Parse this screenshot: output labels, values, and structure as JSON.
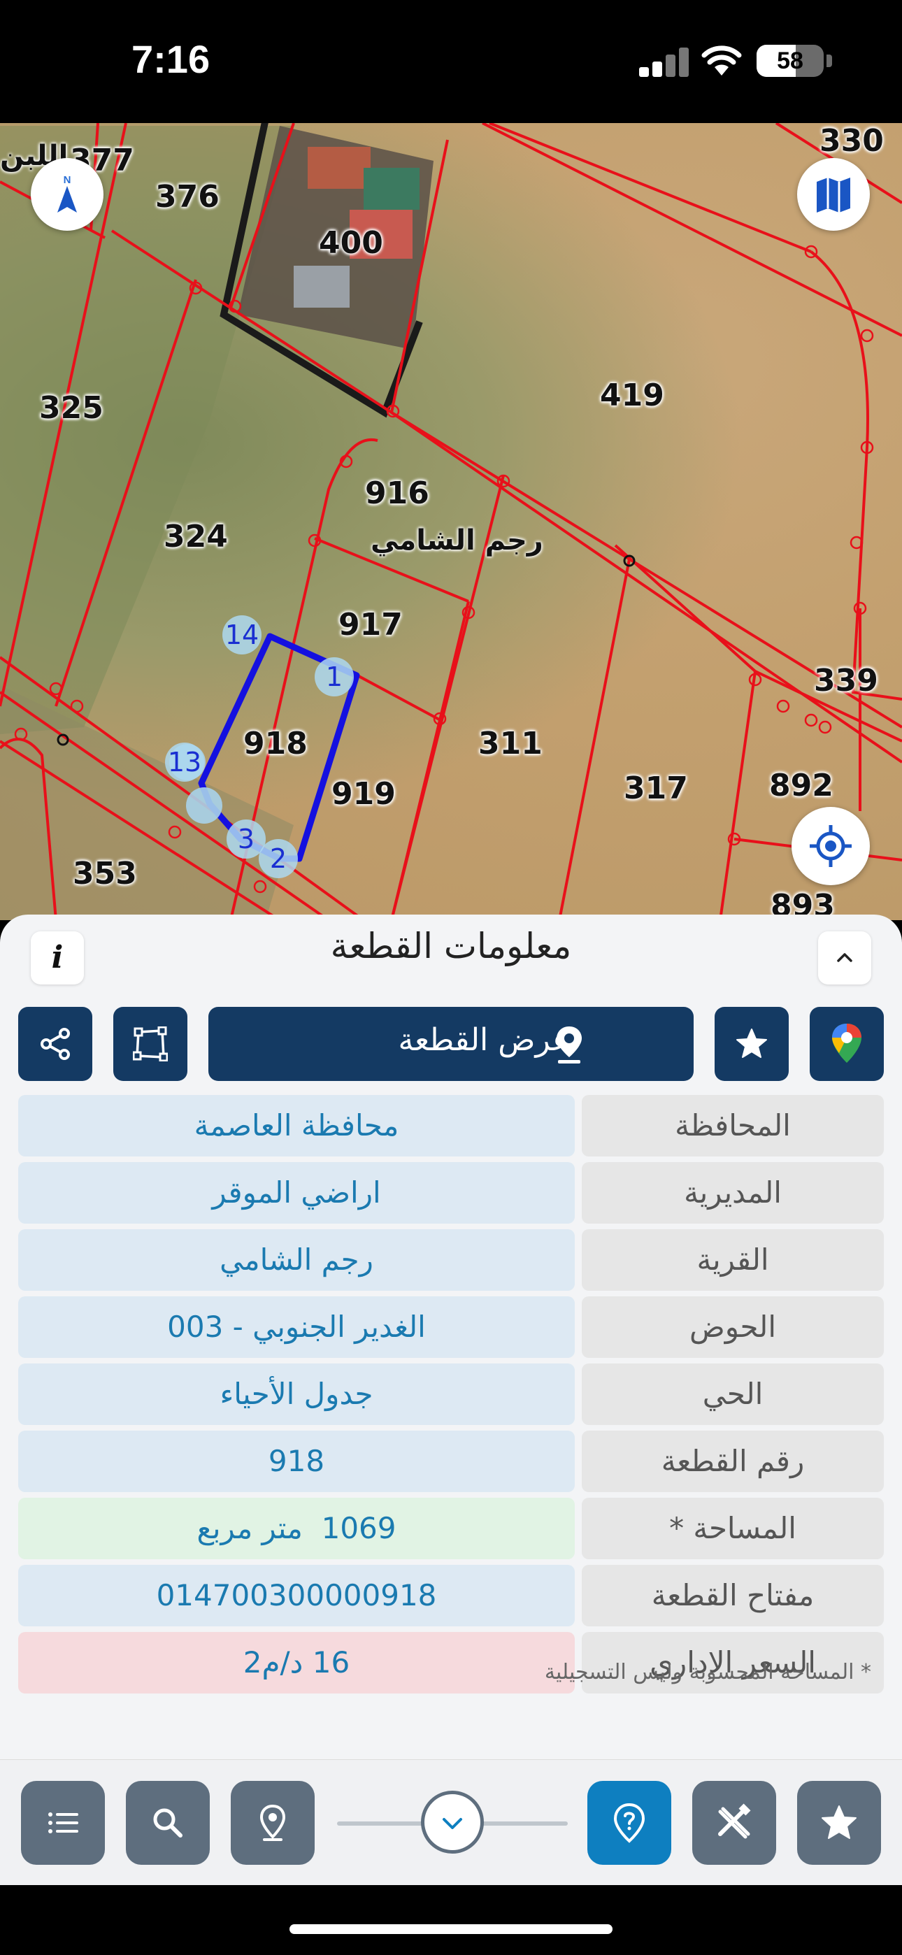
{
  "status_bar": {
    "time": "7:16",
    "battery_percent": 58,
    "battery_level": 0.58
  },
  "map": {
    "parcels": [
      "376",
      "400",
      "377",
      "330",
      "325",
      "419",
      "916",
      "324",
      "917",
      "918",
      "919",
      "311",
      "317",
      "892",
      "339",
      "353",
      "893"
    ],
    "place_names": [
      "رجم الشامي",
      "اللبن"
    ],
    "vertices": [
      "14",
      "1",
      "13",
      "3",
      "2"
    ],
    "icons": {
      "north": "compass-north-icon",
      "layers": "map-layers-icon",
      "locate": "locate-me-icon"
    },
    "north_label": "N",
    "colors": {
      "parcel_lines": "#e8101a",
      "selected_parcel": "#1410e0"
    }
  },
  "sheet": {
    "title": "معلومات القطعة",
    "info_icon": "i",
    "view_parcel_label": "عرض القطعة",
    "rows": [
      {
        "label": "المحافظة",
        "value": "محافظة العاصمة"
      },
      {
        "label": "المديرية",
        "value": "اراضي الموقر"
      },
      {
        "label": "القرية",
        "value": "رجم الشامي"
      },
      {
        "label": "الحوض",
        "value": "الغدير الجنوبي - 003"
      },
      {
        "label": "الحي",
        "value": "جدول الأحياء"
      },
      {
        "label": "رقم القطعة",
        "value": "918"
      },
      {
        "label": "المساحة *",
        "value": "1069  متر مربع"
      },
      {
        "label": "مفتاح القطعة",
        "value": "014700300000918"
      },
      {
        "label": "السعر الإداري",
        "value": "16 د/م2"
      }
    ],
    "footnote": "* المساحة المحسوبة وليس التسجيلية"
  },
  "toolbar": {
    "buttons": [
      "list-icon",
      "search-icon",
      "location-pin-icon",
      "help-pin-icon",
      "tools-icon",
      "favorites-icon"
    ],
    "active": "help-pin-icon"
  }
}
